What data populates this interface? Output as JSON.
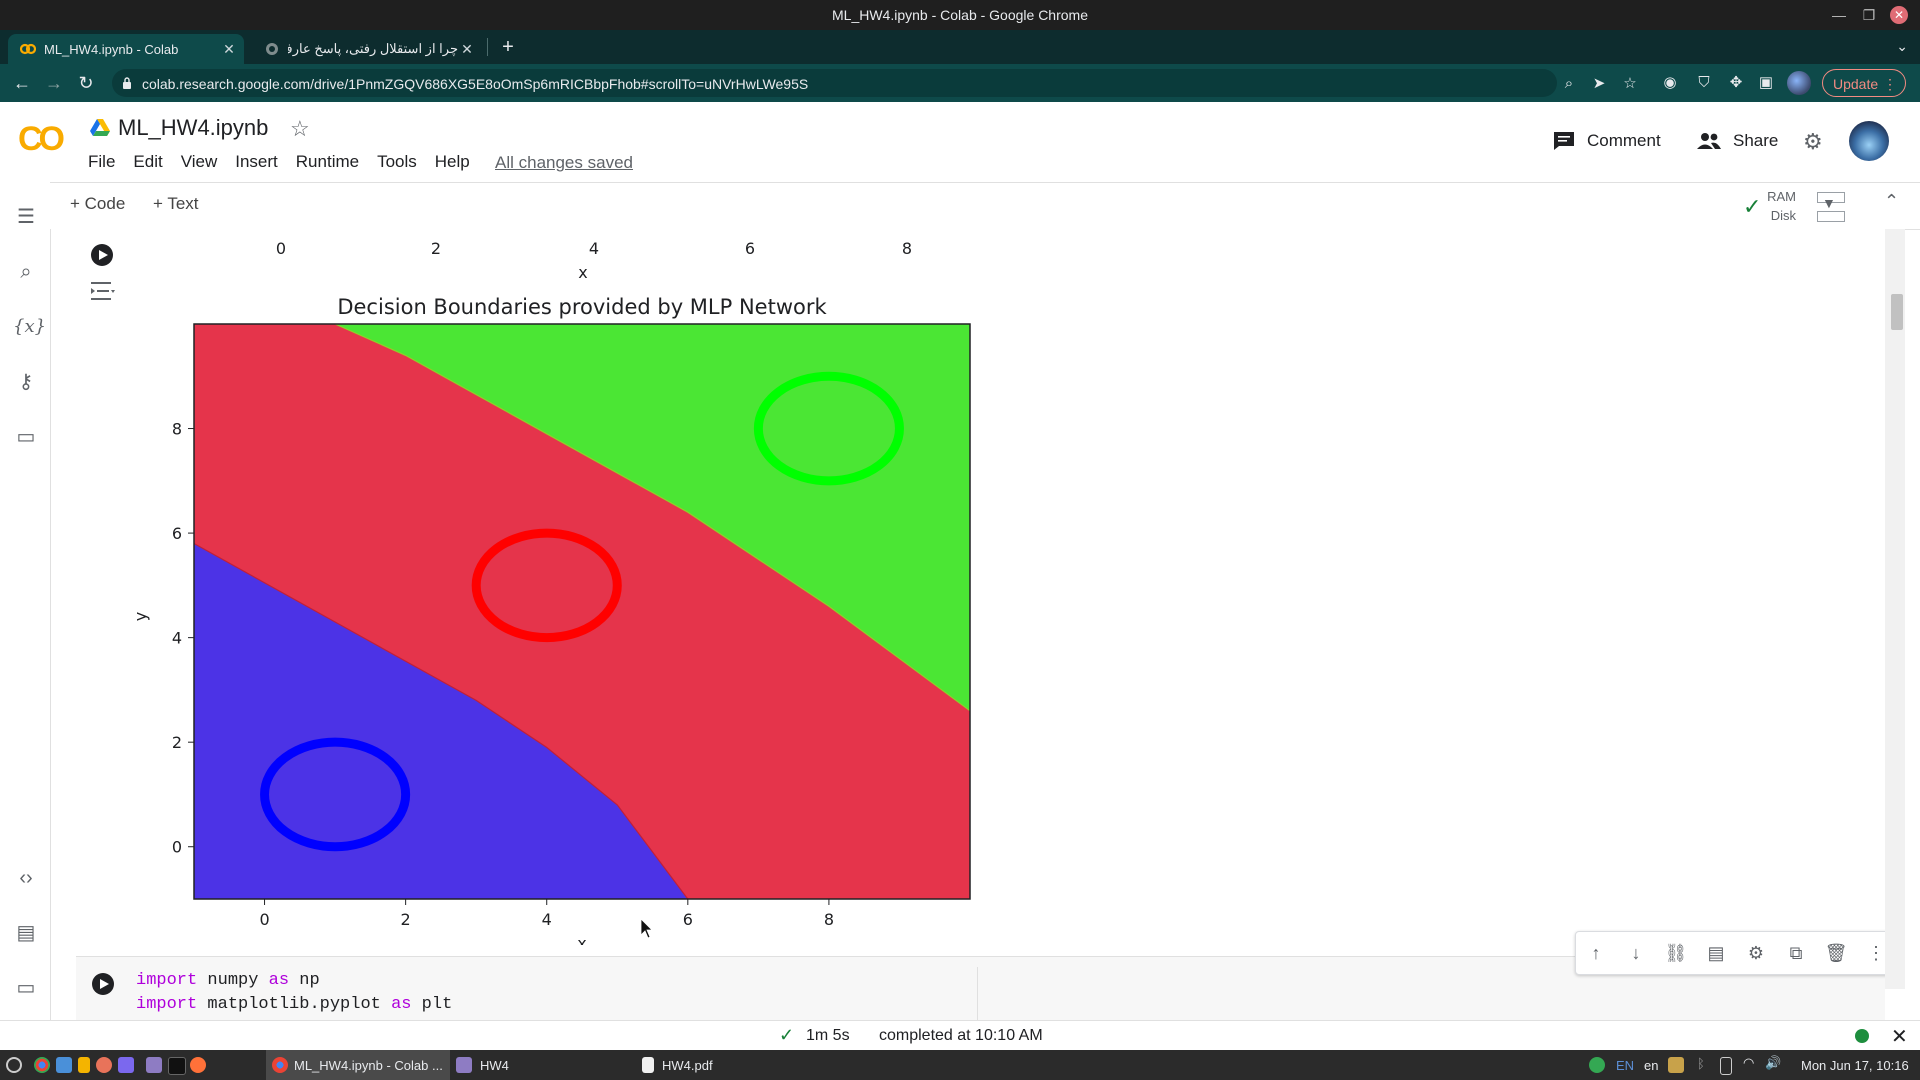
{
  "window": {
    "title": "ML_HW4.ipynb - Colab - Google Chrome"
  },
  "browser": {
    "tabs": [
      {
        "label": "ML_HW4.ipynb - Colab",
        "active": true
      },
      {
        "label": "چرا از استقلال رفتی، پاسخ عارف",
        "active": false
      }
    ],
    "url": "colab.research.google.com/drive/1PnmZGQV686XG5E8oOmSp6mRICBbpFhob#scrollTo=uNVrHwLWe95S",
    "update_label": "Update"
  },
  "colab": {
    "logo": "CO",
    "notebook_title": "ML_HW4.ipynb",
    "menu": [
      "File",
      "Edit",
      "View",
      "Insert",
      "Runtime",
      "Tools",
      "Help"
    ],
    "save_status": "All changes saved",
    "comment_label": "Comment",
    "share_label": "Share",
    "add_code_label": "+ Code",
    "add_text_label": "+ Text",
    "ram_label": "RAM",
    "disk_label": "Disk"
  },
  "prev_output": {
    "x_ticks": [
      "0",
      "2",
      "4",
      "6",
      "8"
    ],
    "x_label": "x"
  },
  "chart_data": {
    "type": "heatmap",
    "title": "Decision Boundaries provided by MLP Network",
    "xlabel": "x",
    "ylabel": "y",
    "xlim": [
      -1,
      10
    ],
    "ylim": [
      -1,
      10
    ],
    "xticks": [
      0,
      2,
      4,
      6,
      8
    ],
    "yticks": [
      0,
      2,
      4,
      6,
      8
    ],
    "regions": [
      {
        "class": "blue",
        "color": "#4c33e6",
        "boundary_to_red": [
          [
            -1,
            5.8
          ],
          [
            1,
            4.3
          ],
          [
            3,
            2.8
          ],
          [
            4,
            1.9
          ],
          [
            5,
            0.8
          ],
          [
            6,
            -1
          ]
        ]
      },
      {
        "class": "red",
        "color": "#e5344b"
      },
      {
        "class": "green",
        "color": "#4be634",
        "boundary_to_red": [
          [
            1.0,
            10
          ],
          [
            2,
            9.4
          ],
          [
            4,
            7.9
          ],
          [
            6,
            6.4
          ],
          [
            8,
            4.6
          ],
          [
            10,
            2.6
          ]
        ]
      }
    ],
    "circles": [
      {
        "cx": 1,
        "cy": 1,
        "r": 1,
        "color": "#0000ff"
      },
      {
        "cx": 4,
        "cy": 5,
        "r": 1,
        "color": "#ff0000"
      },
      {
        "cx": 8,
        "cy": 8,
        "r": 1,
        "color": "#00ff00"
      }
    ]
  },
  "code_cell": {
    "line1": {
      "kw1": "import",
      "mod": "numpy",
      "kw2": "as",
      "alias": "np"
    },
    "line2": {
      "kw1": "import",
      "mod": "matplotlib.pyplot",
      "kw2": "as",
      "alias": "plt"
    }
  },
  "status": {
    "duration": "1m 5s",
    "completed": "completed at 10:10 AM"
  },
  "taskbar": {
    "windows": [
      "ML_HW4.ipynb - Colab ...",
      "HW4",
      "HW4.pdf"
    ],
    "lang": "EN",
    "lang2": "en",
    "clock": "Mon Jun 17, 10:16"
  },
  "colors": {
    "chrome_frame": "#0e4a4a",
    "colab_orange": "#f9ab00",
    "update_red": "#f28b82"
  }
}
